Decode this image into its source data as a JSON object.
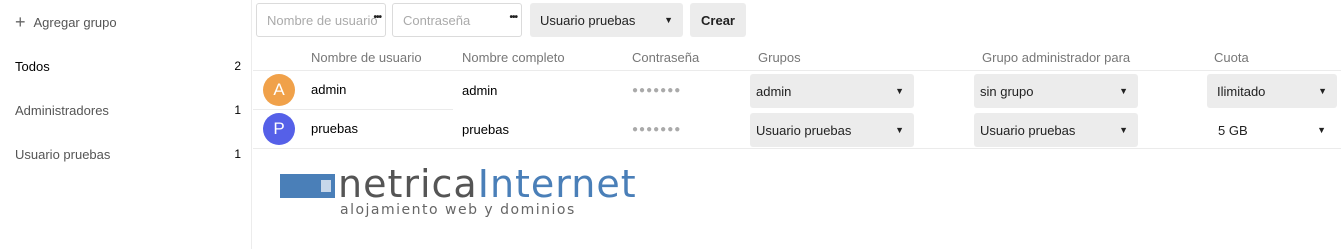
{
  "sidebar": {
    "add_group_label": "Agregar grupo",
    "items": [
      {
        "label": "Todos",
        "count": "2"
      },
      {
        "label": "Administradores",
        "count": "1"
      },
      {
        "label": "Usuario pruebas",
        "count": "1"
      }
    ]
  },
  "toolbar": {
    "username_placeholder": "Nombre de usuario",
    "password_placeholder": "Contraseña",
    "group_select": "Usuario pruebas",
    "create_label": "Crear"
  },
  "table": {
    "headers": [
      "Nombre de usuario",
      "Nombre completo",
      "Contraseña",
      "Grupos",
      "Grupo administrador para",
      "Cuota"
    ],
    "rows": [
      {
        "avatar_letter": "A",
        "avatar_color": "#f0a14a",
        "username": "admin",
        "fullname": "admin",
        "password": "●●●●●●●",
        "groups": "admin",
        "admin_for": "sin grupo",
        "quota": "Ilimitado"
      },
      {
        "avatar_letter": "P",
        "avatar_color": "#5560e8",
        "username": "pruebas",
        "fullname": "pruebas",
        "password": "●●●●●●●",
        "groups": "Usuario pruebas",
        "admin_for": "Usuario pruebas",
        "quota": "5 GB"
      }
    ]
  },
  "logo": {
    "word1": "netrica",
    "word2": "Internet",
    "tagline": "alojamiento web y dominios"
  }
}
